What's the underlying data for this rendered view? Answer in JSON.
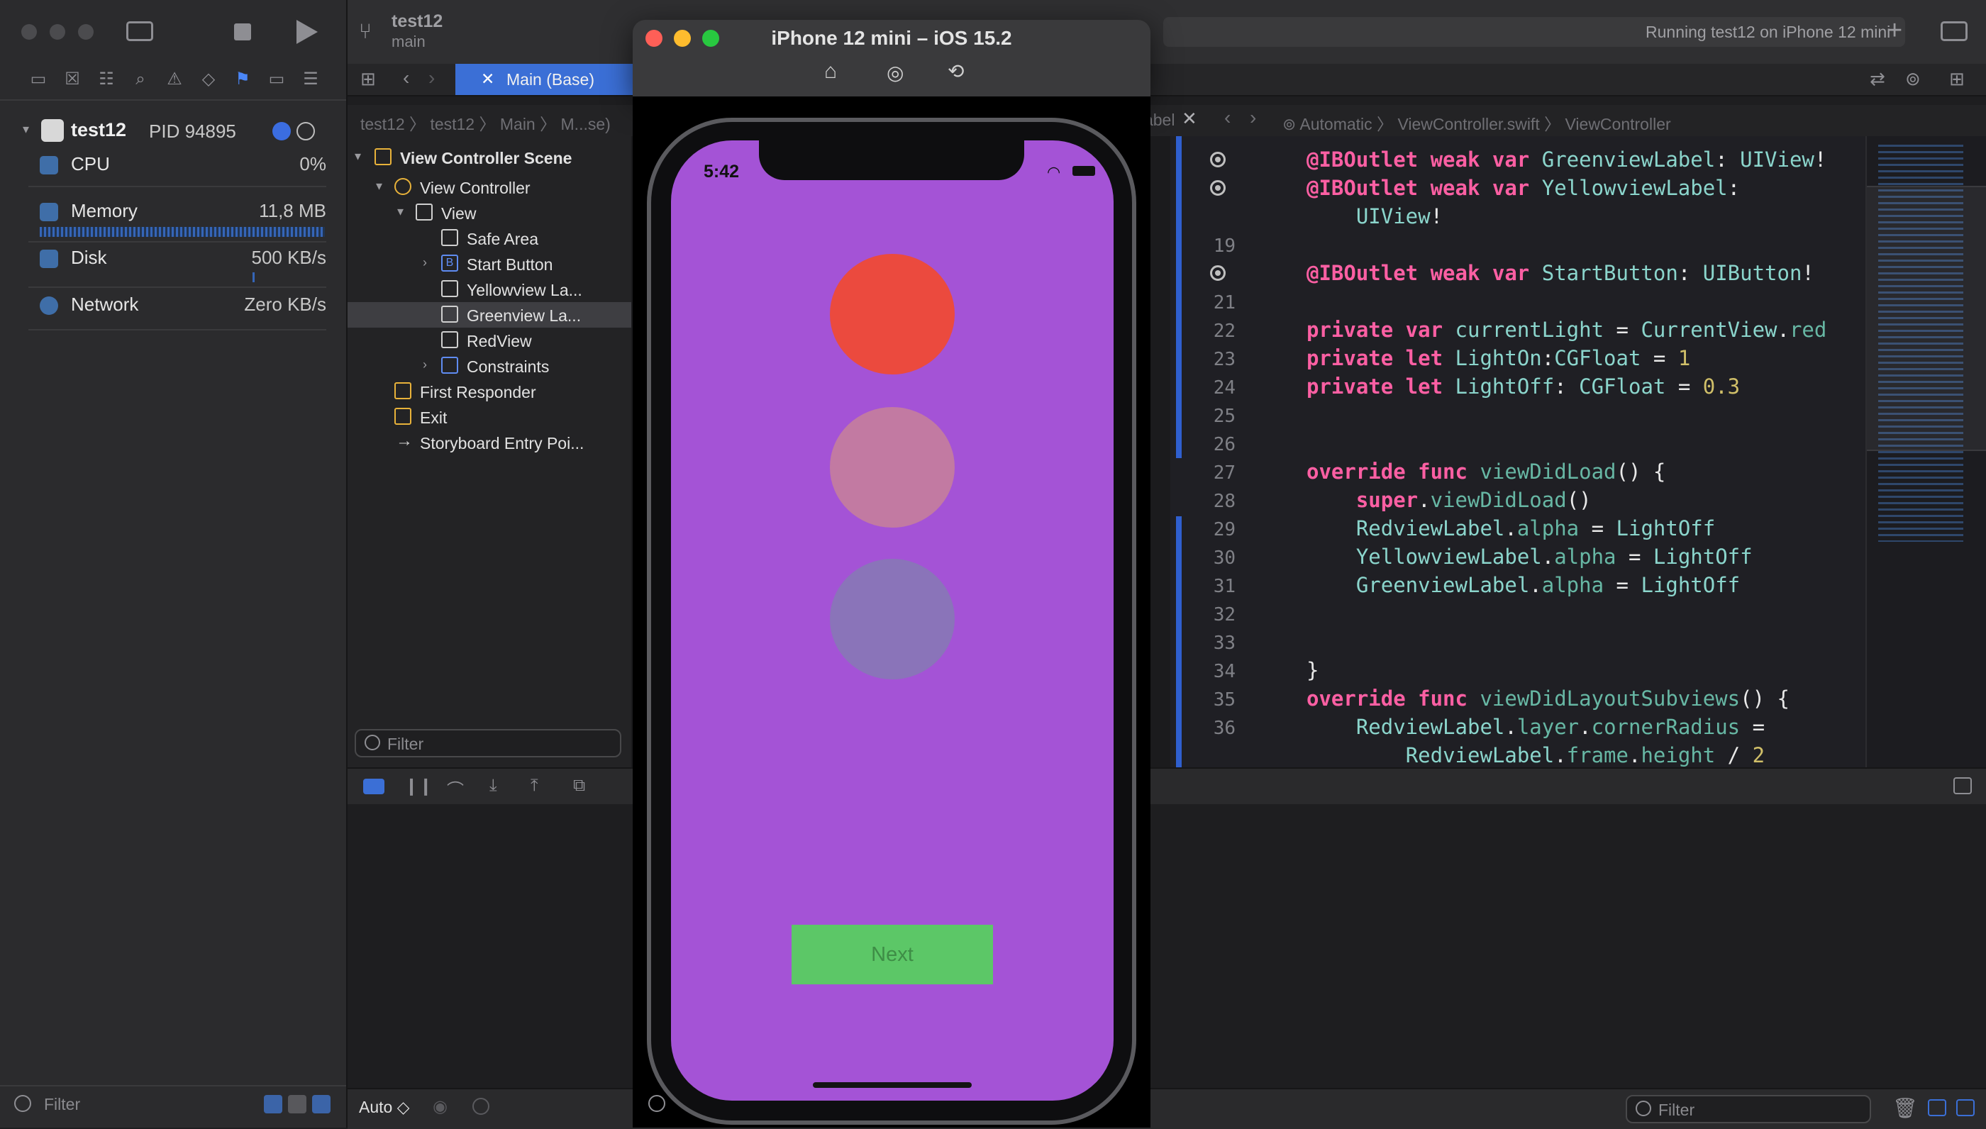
{
  "navigator": {
    "process": {
      "name": "test12",
      "pid": "PID 94895"
    },
    "gauges": [
      {
        "label": "CPU",
        "value": "0%"
      },
      {
        "label": "Memory",
        "value": "11,8 MB"
      },
      {
        "label": "Disk",
        "value": "500 KB/s"
      },
      {
        "label": "Network",
        "value": "Zero KB/s"
      }
    ],
    "filter_placeholder": "Filter"
  },
  "toolbar": {
    "project": "test12",
    "branch": "main",
    "status": "Running test12 on iPhone 12 mini",
    "active_tab": "Main (Base)"
  },
  "jumpbar": {
    "left": [
      "test12",
      "test12",
      "Main",
      "M...se)",
      "...w Label"
    ],
    "right": [
      "Automatic",
      "ViewController.swift",
      "ViewController"
    ]
  },
  "outline": {
    "items": [
      {
        "label": "View Controller Scene"
      },
      {
        "label": "View Controller"
      },
      {
        "label": "View"
      },
      {
        "label": "Safe Area"
      },
      {
        "label": "Start Button"
      },
      {
        "label": "Yellowview La..."
      },
      {
        "label": "Greenview La..."
      },
      {
        "label": "RedView"
      },
      {
        "label": "Constraints"
      },
      {
        "label": "First Responder"
      },
      {
        "label": "Exit"
      },
      {
        "label": "Storyboard Entry Poi..."
      }
    ],
    "filter_placeholder": "Filter"
  },
  "code": {
    "line_numbers": [
      "",
      "",
      "",
      "19",
      "",
      "21",
      "22",
      "23",
      "24",
      "25",
      "26",
      "27",
      "28",
      "29",
      "30",
      "31",
      "32",
      "33",
      "34",
      "35",
      "36",
      ""
    ]
  },
  "simulator": {
    "title": "iPhone 12 mini – iOS 15.2",
    "time": "5:42",
    "button_label": "Next",
    "lights": [
      {
        "color": "#eb4a3e",
        "opacity": 1
      },
      {
        "color": "#c27aa2",
        "opacity": 1
      },
      {
        "color": "#8a74b9",
        "opacity": 1
      }
    ]
  },
  "debug": {
    "auto_label": "Auto ◇",
    "filter_placeholder": "Filter"
  }
}
